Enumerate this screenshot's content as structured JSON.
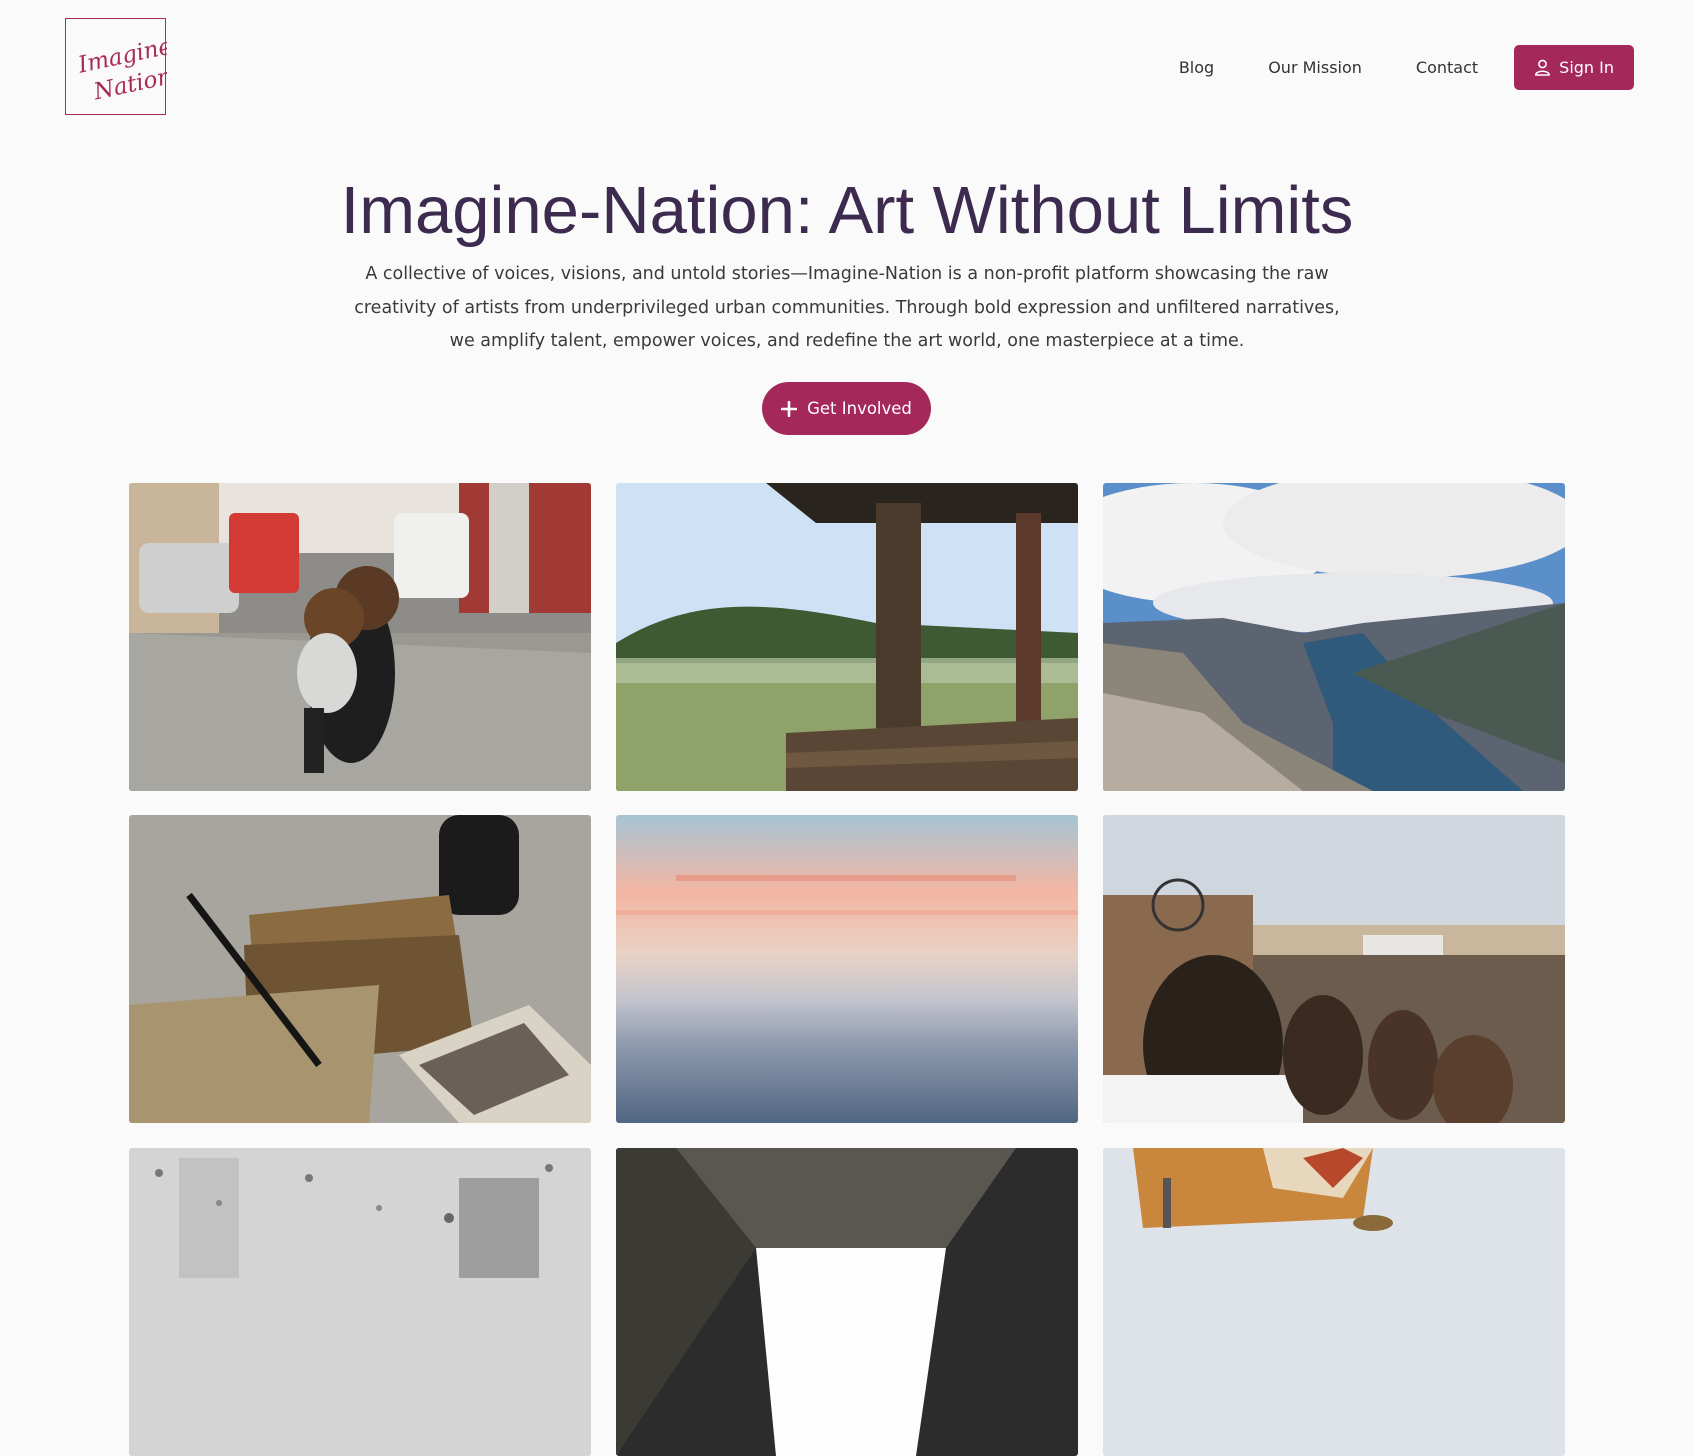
{
  "logo": {
    "text_line1": "Imagine",
    "text_line2": "Nation",
    "color": "#a82a59"
  },
  "nav": {
    "items": [
      {
        "label": "Blog"
      },
      {
        "label": "Our Mission"
      },
      {
        "label": "Contact"
      }
    ],
    "signin_label": "Sign In"
  },
  "hero": {
    "title": "Imagine-Nation: Art Without Limits",
    "description": "A collective of voices, visions, and untold stories—Imagine-Nation is a non-profit platform showcasing the raw creativity of artists from underprivileged urban communities. Through bold expression and unfiltered narratives, we amplify talent, empower voices, and redefine the art world, one masterpiece at a time.",
    "cta_label": "Get Involved"
  },
  "colors": {
    "accent": "#a4285a",
    "title": "#3d2a4f",
    "background": "#fafafa"
  },
  "gallery": [
    {
      "subject": "mother and child on cobblestone street"
    },
    {
      "subject": "misty lake from wooden pier"
    },
    {
      "subject": "fjord from mountain cliff"
    },
    {
      "subject": "bundled old letters and ink bottle"
    },
    {
      "subject": "sunset over misty sea"
    },
    {
      "subject": "crowd on pier with ferris wheel"
    },
    {
      "subject": "raindrops on window with city"
    },
    {
      "subject": "looking up between buildings"
    },
    {
      "subject": "colorful blankets on chairs"
    }
  ]
}
